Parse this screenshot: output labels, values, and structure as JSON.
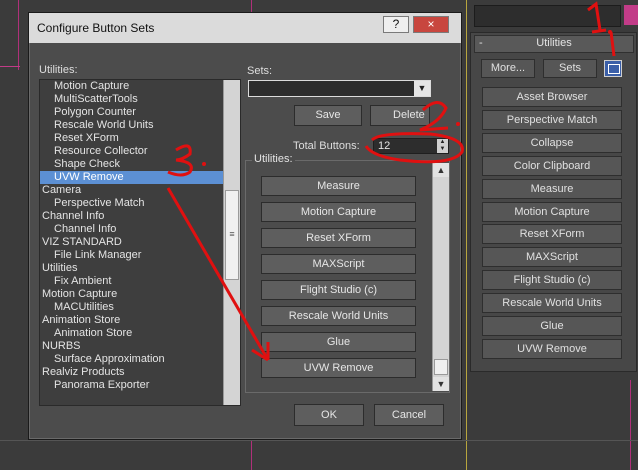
{
  "dialog": {
    "title": "Configure Button Sets",
    "help_label": "?",
    "close_label": "×",
    "utilities_label": "Utilities:",
    "sets_label": "Sets:",
    "save_label": "Save",
    "delete_label": "Delete",
    "total_buttons_label": "Total Buttons:",
    "total_buttons_value": "12",
    "utilities_group_label": "Utilities:",
    "ok_label": "OK",
    "cancel_label": "Cancel",
    "list_items": [
      {
        "label": "Motion Capture",
        "indent": 1,
        "selected": false
      },
      {
        "label": "MultiScatterTools",
        "indent": 1,
        "selected": false
      },
      {
        "label": "Polygon Counter",
        "indent": 1,
        "selected": false
      },
      {
        "label": "Rescale World Units",
        "indent": 1,
        "selected": false
      },
      {
        "label": "Reset XForm",
        "indent": 1,
        "selected": false
      },
      {
        "label": "Resource Collector",
        "indent": 1,
        "selected": false
      },
      {
        "label": "Shape Check",
        "indent": 1,
        "selected": false
      },
      {
        "label": "UVW Remove",
        "indent": 1,
        "selected": true
      },
      {
        "label": "Camera",
        "indent": 0,
        "selected": false
      },
      {
        "label": "Perspective Match",
        "indent": 1,
        "selected": false
      },
      {
        "label": "Channel Info",
        "indent": 0,
        "selected": false
      },
      {
        "label": "Channel Info",
        "indent": 1,
        "selected": false
      },
      {
        "label": "VIZ STANDARD",
        "indent": 0,
        "selected": false
      },
      {
        "label": "File Link Manager",
        "indent": 1,
        "selected": false
      },
      {
        "label": "Utilities",
        "indent": 0,
        "selected": false
      },
      {
        "label": "Fix Ambient",
        "indent": 1,
        "selected": false
      },
      {
        "label": "Motion Capture",
        "indent": 0,
        "selected": false
      },
      {
        "label": "MACUtilities",
        "indent": 1,
        "selected": false
      },
      {
        "label": "Animation Store",
        "indent": 0,
        "selected": false
      },
      {
        "label": "Animation Store",
        "indent": 1,
        "selected": false
      },
      {
        "label": "NURBS",
        "indent": 0,
        "selected": false
      },
      {
        "label": "Surface Approximation",
        "indent": 1,
        "selected": false
      },
      {
        "label": "Realviz Products",
        "indent": 0,
        "selected": false
      },
      {
        "label": "Panorama Exporter",
        "indent": 1,
        "selected": false
      }
    ],
    "group_buttons": [
      "Measure",
      "Motion Capture",
      "Reset XForm",
      "MAXScript",
      "Flight Studio (c)",
      "Rescale World Units",
      "Glue",
      "UVW Remove"
    ]
  },
  "panel": {
    "rollout_title": "Utilities",
    "rollout_toggle": "-",
    "more_label": "More...",
    "sets_label": "Sets",
    "buttons": [
      "Asset Browser",
      "Perspective Match",
      "Collapse",
      "Color Clipboard",
      "Measure",
      "Motion Capture",
      "Reset XForm",
      "MAXScript",
      "Flight Studio (c)",
      "Rescale World Units",
      "Glue",
      "UVW Remove"
    ]
  },
  "annotations": {
    "step1": "1.",
    "step2": "2.",
    "step3": "3."
  },
  "colors": {
    "annotation": "#e01010",
    "selection": "#5c90d4",
    "viewport_magenta": "#c23c88",
    "viewport_yellow": "#d6c24a"
  }
}
